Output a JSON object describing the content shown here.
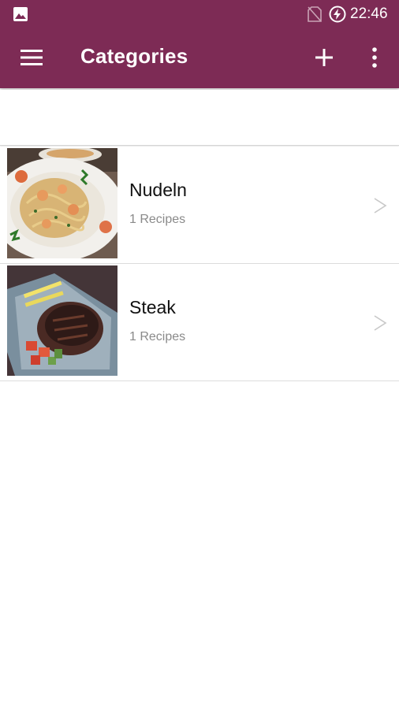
{
  "status_bar": {
    "time": "22:46",
    "icons": [
      "image-icon",
      "no-sim-icon",
      "battery-charging-icon"
    ]
  },
  "app_bar": {
    "title": "Categories",
    "icons": [
      "menu-icon",
      "add-icon",
      "more-vert-icon"
    ],
    "color": "#7d2b55"
  },
  "categories": [
    {
      "name": "Nudeln",
      "count": "1 Recipes",
      "image": "pasta-shrimp-dish"
    },
    {
      "name": "Steak",
      "count": "1 Recipes",
      "image": "grilled-steak-dish"
    }
  ],
  "chevron": ">"
}
